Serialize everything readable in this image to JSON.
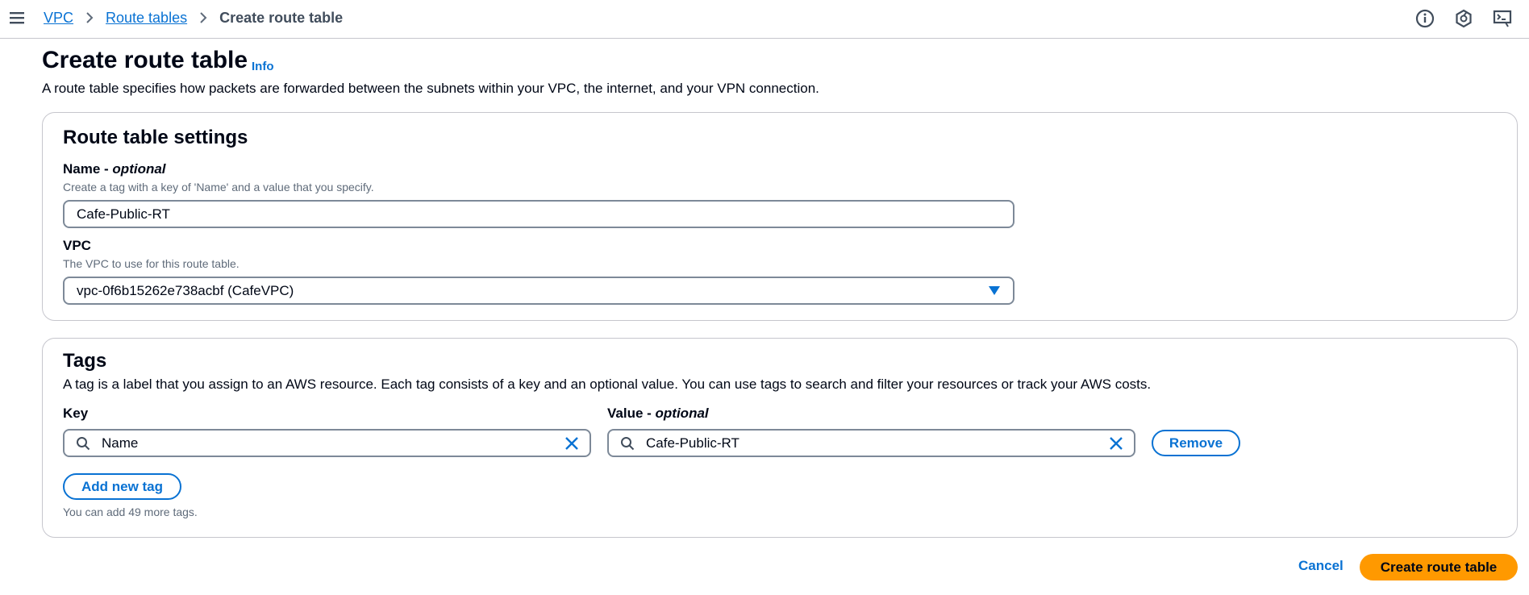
{
  "breadcrumb": {
    "items": [
      "VPC",
      "Route tables"
    ],
    "current": "Create route table"
  },
  "header": {
    "title": "Create route table",
    "info": "Info",
    "description": "A route table specifies how packets are forwarded between the subnets within your VPC, the internet, and your VPN connection."
  },
  "settings": {
    "title": "Route table settings",
    "name_label": "Name - ",
    "name_label_optional": "optional",
    "name_description": "Create a tag with a key of 'Name' and a value that you specify.",
    "name_value": "Cafe-Public-RT",
    "vpc_label": "VPC",
    "vpc_description": "The VPC to use for this route table.",
    "vpc_value": "vpc-0f6b15262e738acbf (CafeVPC)"
  },
  "tags": {
    "title": "Tags",
    "description": "A tag is a label that you assign to an AWS resource. Each tag consists of a key and an optional value. You can use tags to search and filter your resources or track your AWS costs.",
    "key_label": "Key",
    "value_label": "Value - ",
    "value_label_optional": "optional",
    "rows": [
      {
        "key": "Name",
        "value": "Cafe-Public-RT"
      }
    ],
    "remove_label": "Remove",
    "add_label": "Add new tag",
    "hint": "You can add 49 more tags."
  },
  "footer": {
    "cancel_label": "Cancel",
    "create_label": "Create route table"
  },
  "colors": {
    "link": "#0972d3",
    "primary": "#ff9900",
    "border": "#7d8998"
  },
  "icons": [
    "menu-icon",
    "chevron-right-icon",
    "info-icon",
    "notifications-icon",
    "cloudshell-icon",
    "caret-down-icon",
    "search-icon",
    "close-icon"
  ]
}
